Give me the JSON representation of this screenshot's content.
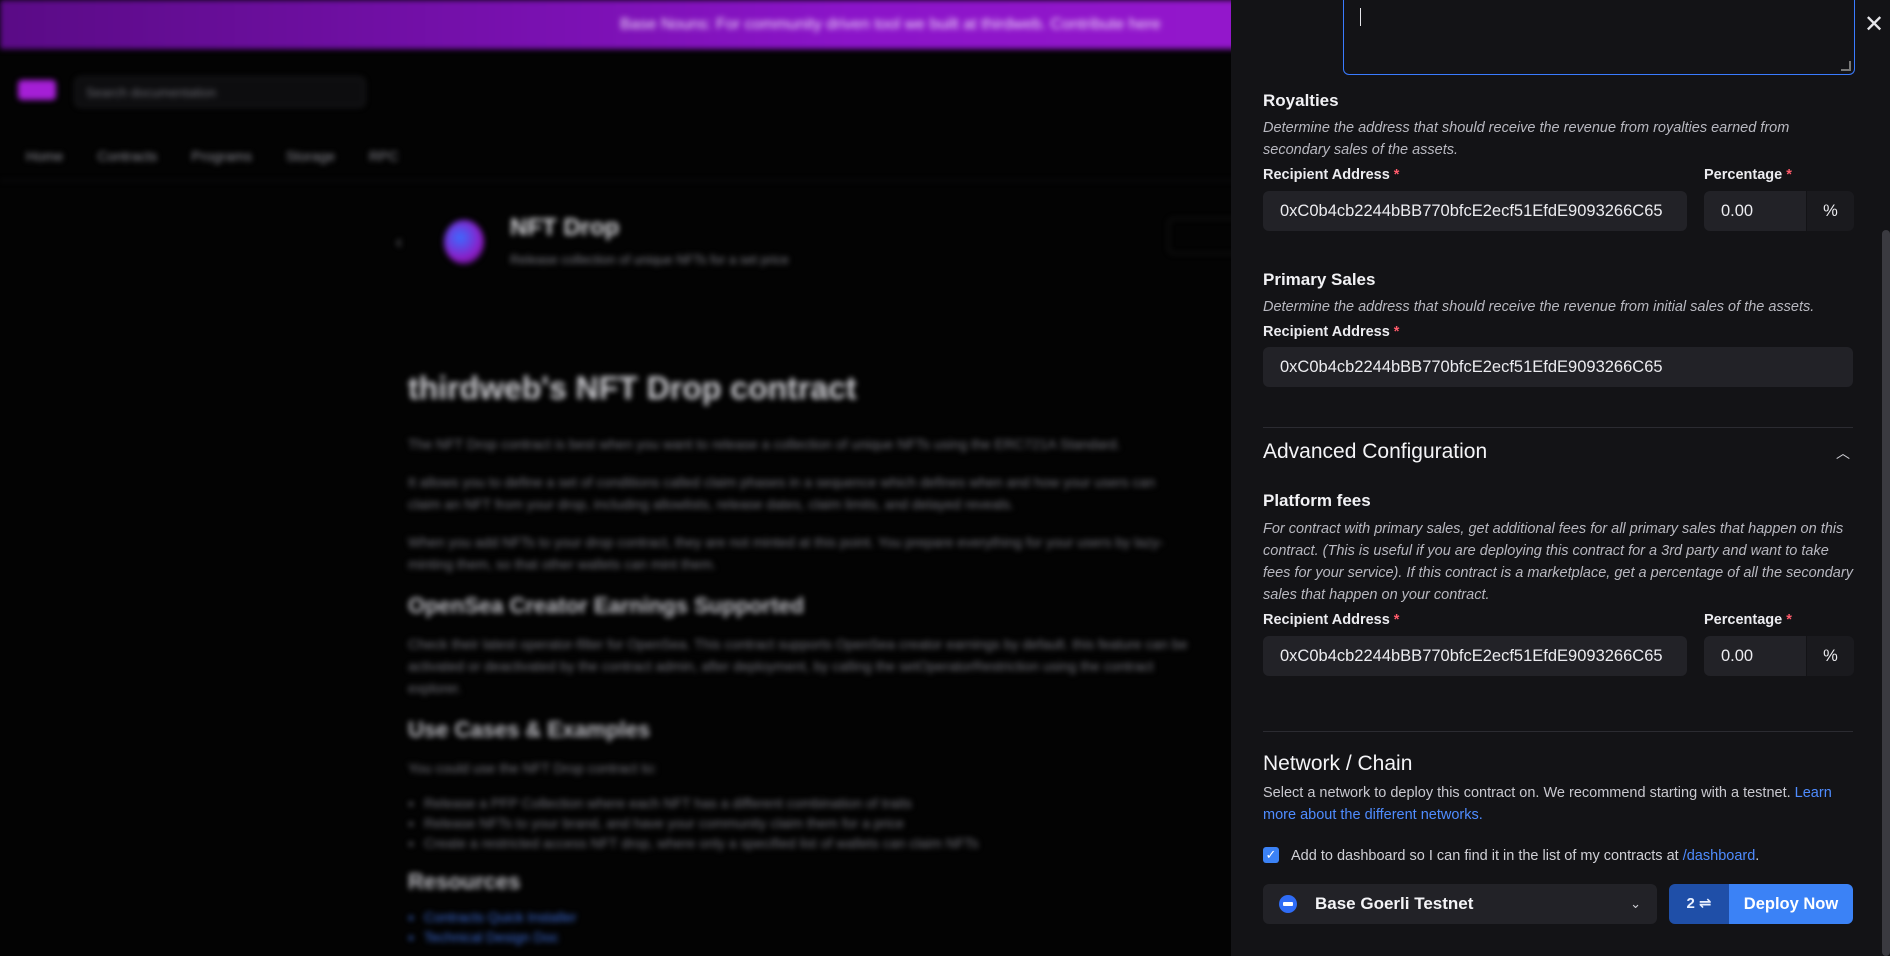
{
  "background": {
    "banner_text": "Base Nouns: For community driven tool we built at thirdweb. Contribute here",
    "search_placeholder": "Search documentation",
    "nav": [
      "Home",
      "Contracts",
      "Programs",
      "Storage",
      "RPC"
    ],
    "product": {
      "title": "NFT Drop",
      "subtitle": "Release collection of unique NFTs for a set price"
    },
    "article": {
      "h1": "thirdweb's NFT Drop contract",
      "p1": "The NFT Drop contract is best when you want to release a collection of unique NFTs using the ERC721A Standard.",
      "p2": "It allows you to define a set of conditions called claim phases in a sequence which defines when and how your users can claim an NFT from your drop, including allowlists, release dates, claim limits, and delayed reveals.",
      "p3": "When you add NFTs to your drop contract, they are not minted at this point. You prepare everything for your users by lazy-minting them, so that other wallets can mint them.",
      "h2a": "OpenSea Creator Earnings Supported",
      "p4": "Check their latest operator-filter for OpenSea. This contract supports OpenSea creator earnings by default. this feature can be activated or deactivated by the contract admin, after deployment, by calling the setOperatorRestriction using the contract explorer.",
      "h2b": "Use Cases & Examples",
      "p5": "You could use the NFT Drop contract to:",
      "li": [
        "Release a PFP Collection where each NFT has a different combination of traits",
        "Release NFTs to your brand, and have your community claim them for a price",
        "Create a restricted access NFT drop, where only a specified list of wallets can claim NFTs"
      ],
      "h2c": "Resources",
      "res": [
        "Contracts Quick Installer",
        "Technical Design Doc"
      ]
    }
  },
  "drawer": {
    "royalties": {
      "title": "Royalties",
      "desc": "Determine the address that should receive the revenue from royalties earned from secondary sales of the assets.",
      "recipient_label": "Recipient Address",
      "recipient_value": "0xC0b4cb2244bBB770bfcE2ecf51EfdE9093266C65",
      "percentage_label": "Percentage",
      "percentage_value": "0.00",
      "percentage_addon": "%"
    },
    "primary_sales": {
      "title": "Primary Sales",
      "desc": "Determine the address that should receive the revenue from initial sales of the assets.",
      "recipient_label": "Recipient Address",
      "recipient_value": "0xC0b4cb2244bBB770bfcE2ecf51EfdE9093266C65"
    },
    "advanced": {
      "title": "Advanced Configuration",
      "platform_fees_title": "Platform fees",
      "platform_fees_desc": "For contract with primary sales, get additional fees for all primary sales that happen on this contract. (This is useful if you are deploying this contract for a 3rd party and want to take fees for your service). If this contract is a marketplace, get a percentage of all the secondary sales that happen on your contract.",
      "recipient_label": "Recipient Address",
      "recipient_value": "0xC0b4cb2244bBB770bfcE2ecf51EfdE9093266C65",
      "percentage_label": "Percentage",
      "percentage_value": "0.00",
      "percentage_addon": "%"
    },
    "required_mark": "*",
    "network": {
      "title": "Network / Chain",
      "desc": "Select a network to deploy this contract on. We recommend starting with a testnet.",
      "learn_link": "Learn more about the different networks.",
      "checkbox_text": "Add to dashboard so I can find it in the list of my contracts at",
      "checkbox_link": "/dashboard",
      "checkbox_end": ".",
      "checkbox_checked": true,
      "chain_selected": "Base Goerli Testnet",
      "tx_count": "2 ⇌",
      "deploy_label": "Deploy Now"
    },
    "colors": {
      "accent": "#3b82f6",
      "required": "#ff5b6b",
      "link": "#4f8cff",
      "drawer_bg": "#131316"
    }
  }
}
